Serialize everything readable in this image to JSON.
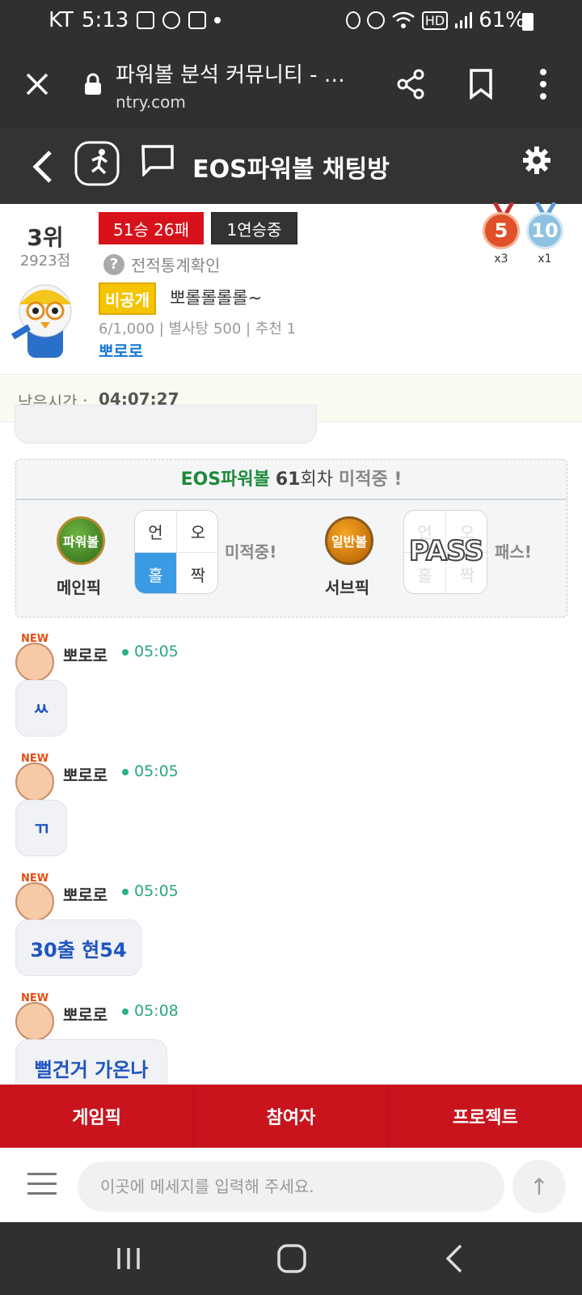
{
  "status_bar": {
    "carrier": "KT",
    "time": "5:13",
    "hd_label": "HD",
    "battery": "61%"
  },
  "browser": {
    "page_title": "파워볼 분석 커뮤니티 - …",
    "url": "ntry.com"
  },
  "header": {
    "title": "EOS파워볼 채팅방"
  },
  "profile": {
    "rank": "3위",
    "points": "2923점",
    "record": "51승 26패",
    "streak": "1연승중",
    "stats_link": "전적통계확인",
    "help_glyph": "?",
    "medals": [
      {
        "value": "5",
        "count": "x3",
        "color": "#e0502a"
      },
      {
        "value": "10",
        "count": "x1",
        "color": "#8fc1e0"
      }
    ],
    "private_badge": "비공개",
    "room_name": "뽀롤롤롤롤~",
    "room_stats": "6/1,000 | 별사탕 500 | 추천 1",
    "owner": "뽀로로"
  },
  "timer": {
    "label": "남은시간 :",
    "value": "04:07:27"
  },
  "pick_card": {
    "game": "EOS파워볼",
    "round_number": "61",
    "round_suffix": "회차",
    "status": "미적중 !",
    "main": {
      "ball_label": "파워볼",
      "label": "메인픽",
      "cells": [
        "언",
        "오",
        "홀",
        "짝"
      ],
      "selected": "홀",
      "result": "미적중!"
    },
    "sub": {
      "ball_label": "일반볼",
      "label": "서브픽",
      "cells": [
        "언",
        "오",
        "홀",
        "짝"
      ],
      "overlay": "PASS",
      "result": "패스!"
    }
  },
  "messages": [
    {
      "badge": "NEW",
      "name": "뽀로로",
      "time": "05:05",
      "text": "ㅆ"
    },
    {
      "badge": "NEW",
      "name": "뽀로로",
      "time": "05:05",
      "text": "ㄲ"
    },
    {
      "badge": "NEW",
      "name": "뽀로로",
      "time": "05:05",
      "text": "30출 현54"
    },
    {
      "badge": "NEW",
      "name": "뽀로로",
      "time": "05:08",
      "text": "뻘건거 가온나"
    }
  ],
  "tabs": [
    "게임픽",
    "참여자",
    "프로젝트"
  ],
  "composer": {
    "placeholder": "이곳에 메세지를 입력해 주세요.",
    "send_glyph": "↑"
  },
  "colors": {
    "accent_red": "#c9141e",
    "dark_bar": "#303030",
    "link_blue": "#1a78d4",
    "game_green": "#1e8a3a"
  }
}
